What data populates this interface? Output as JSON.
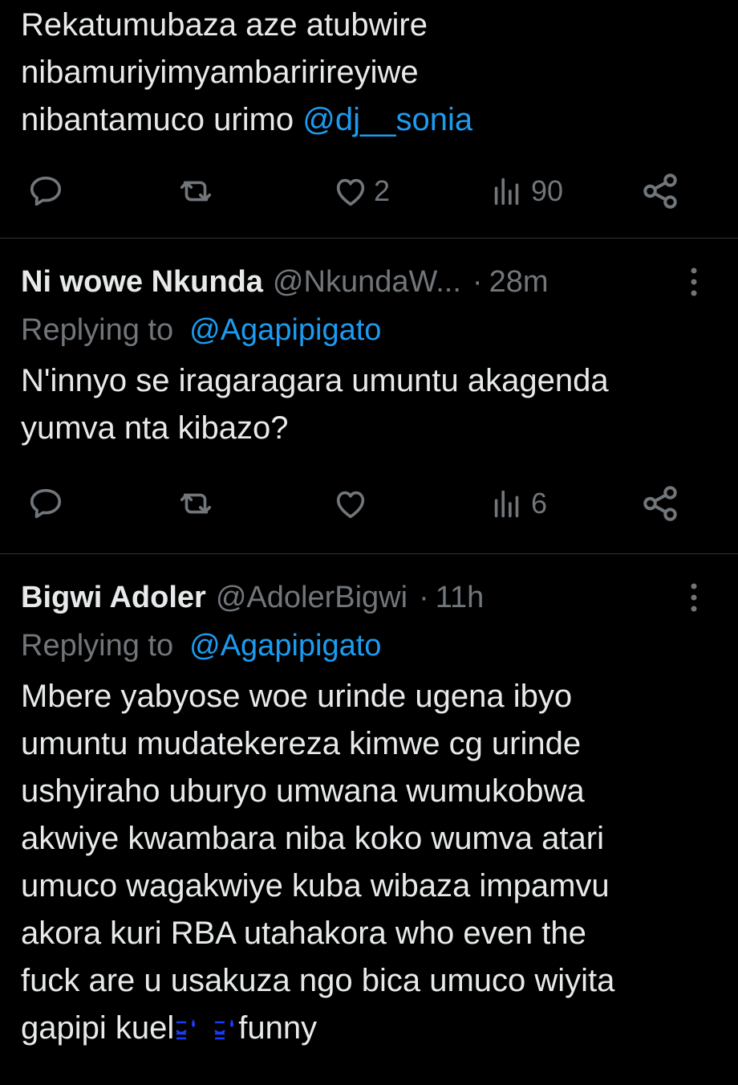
{
  "tweets": [
    {
      "text_lines": [
        "Rekatumubaza aze atubwire",
        "nibamuriyimyambaririreyiwe",
        "nibantamuco urimo "
      ],
      "mention": "@dj__sonia",
      "actions": {
        "reply_count": "",
        "retweet_count": "",
        "like_count": "2",
        "view_count": "90"
      }
    },
    {
      "name": "Ni wowe Nkunda",
      "handle": "@NkundaW...",
      "dot": "·",
      "time": "28m",
      "replying_prefix": "Replying to",
      "replying_to": "@Agapipigato",
      "text": "N'innyo se iragaragara umuntu akagenda\nyumva nta kibazo?",
      "actions": {
        "reply_count": "",
        "retweet_count": "",
        "like_count": "",
        "view_count": "6"
      }
    },
    {
      "name": "Bigwi Adoler",
      "handle": "@AdolerBigwi",
      "dot": "·",
      "time": "11h",
      "replying_prefix": "Replying to",
      "replying_to": "@Agapipigato",
      "text": "Mbere yabyose woe urinde ugena ibyo\numuntu mudatekereza kimwe cg urinde\nushyiraho uburyo umwana wumukobwa\nakwiye kwambara niba koko wumva atari\numuco wagakwiye kuba wibaza impamvu\nakora kuri RBA utahakora who even the\nfuck are u usakuza ngo bica umuco wiyita\ngapipi kuel",
      "text_end": "funny",
      "emoji": [
        "sweat-smile-emoji",
        "sweat-smile-emoji"
      ]
    }
  ],
  "icons": {
    "reply": "reply-bubble-icon",
    "retweet": "retweet-icon",
    "like": "heart-icon",
    "views": "views-bar-chart-icon",
    "share": "share-icon",
    "more": "more-vertical-icon"
  },
  "colors": {
    "background": "#000000",
    "text": "#e7e9ea",
    "muted": "#71767b",
    "link": "#1d9bf0",
    "divider": "#2f3336",
    "emoji": "#1a3cff"
  }
}
